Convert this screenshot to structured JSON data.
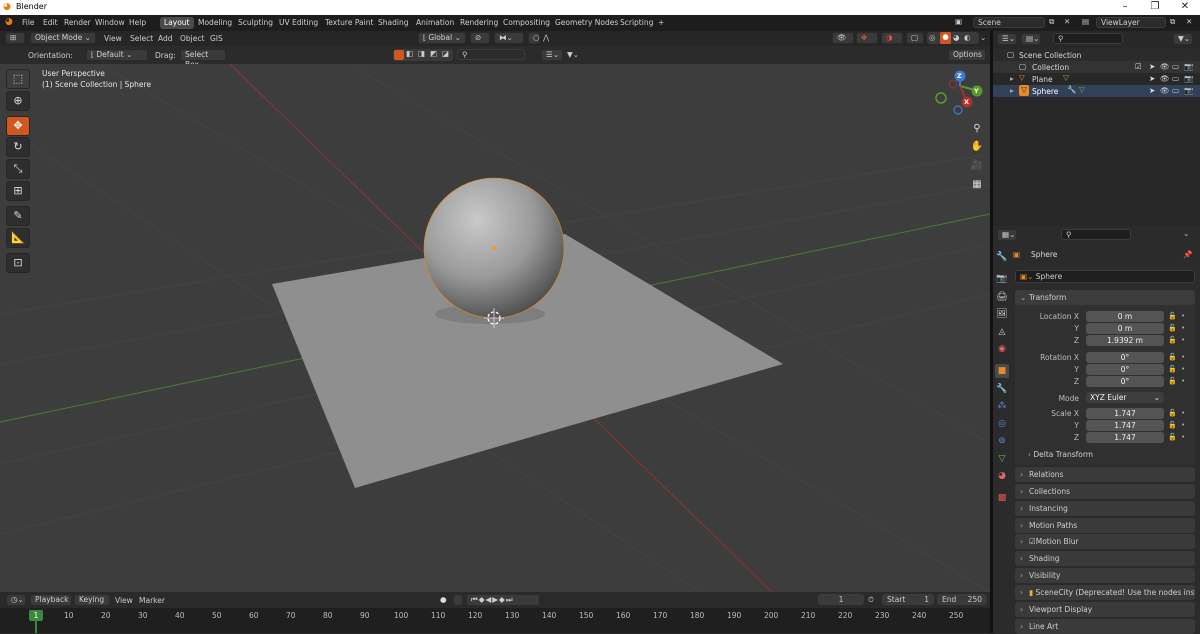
{
  "window": {
    "title": "Blender",
    "controls": [
      "–",
      "❐",
      "✕"
    ]
  },
  "menus": [
    "File",
    "Edit",
    "Render",
    "Window",
    "Help"
  ],
  "workspaces": [
    "Layout",
    "Modeling",
    "Sculpting",
    "UV Editing",
    "Texture Paint",
    "Shading",
    "Animation",
    "Rendering",
    "Compositing",
    "Geometry Nodes",
    "Scripting"
  ],
  "active_workspace": "Layout",
  "add_tab": "+",
  "scene": {
    "label": "Scene",
    "viewlayer": "ViewLayer"
  },
  "viewport_header": {
    "mode": "Object Mode",
    "menus": [
      "View",
      "Select",
      "Add",
      "Object",
      "GIS"
    ],
    "transform_orientation": "Global",
    "orientation_label": "Orientation:",
    "orientation_value": "Default",
    "drag_label": "Drag:",
    "drag_value": "Select Box",
    "options": "Options"
  },
  "viewport": {
    "perspective": "User Perspective",
    "context": "(1) Scene Collection | Sphere"
  },
  "gizmo": {
    "z": "Z",
    "y": "Y",
    "x": "X"
  },
  "tools": [
    "select-box",
    "cursor",
    "move",
    "rotate",
    "scale",
    "transform",
    "annotate",
    "measure",
    "add-cube"
  ],
  "timeline": {
    "menus": [
      "Playback",
      "Keying",
      "View",
      "Marker"
    ],
    "current_frame": "1",
    "start_label": "Start",
    "start": "1",
    "end_label": "End",
    "end": "250",
    "ticks": [
      "1",
      "10",
      "20",
      "30",
      "40",
      "50",
      "60",
      "70",
      "80",
      "90",
      "100",
      "110",
      "120",
      "130",
      "140",
      "150",
      "160",
      "170",
      "180",
      "190",
      "200",
      "210",
      "220",
      "230",
      "240",
      "250"
    ]
  },
  "outliner": {
    "root": "Scene Collection",
    "items": [
      {
        "name": "Collection"
      },
      {
        "name": "Plane"
      },
      {
        "name": "Sphere"
      }
    ]
  },
  "properties": {
    "object_name": "Sphere",
    "datablock": "Sphere",
    "transform_title": "Transform",
    "location": {
      "label": "Location X",
      "x": "0 m",
      "y": "0 m",
      "z": "1.9392 m"
    },
    "rotation": {
      "label": "Rotation X",
      "x": "0°",
      "y": "0°",
      "z": "0°"
    },
    "mode_label": "Mode",
    "mode": "XYZ Euler",
    "scale": {
      "label": "Scale X",
      "x": "1.747",
      "y": "1.747",
      "z": "1.747"
    },
    "axis_y": "Y",
    "axis_z": "Z",
    "delta": "Delta Transform",
    "panels": [
      "Relations",
      "Collections",
      "Instancing",
      "Motion Paths",
      "Motion Blur",
      "Shading",
      "Visibility",
      "SceneCity (Deprecated! Use the nodes instead)",
      "Viewport Display",
      "Line Art"
    ]
  },
  "colors": {
    "accent": "#d4561f",
    "axis_x": "#b03030",
    "axis_y": "#5a9a2a",
    "axis_z": "#3a7bd5"
  }
}
